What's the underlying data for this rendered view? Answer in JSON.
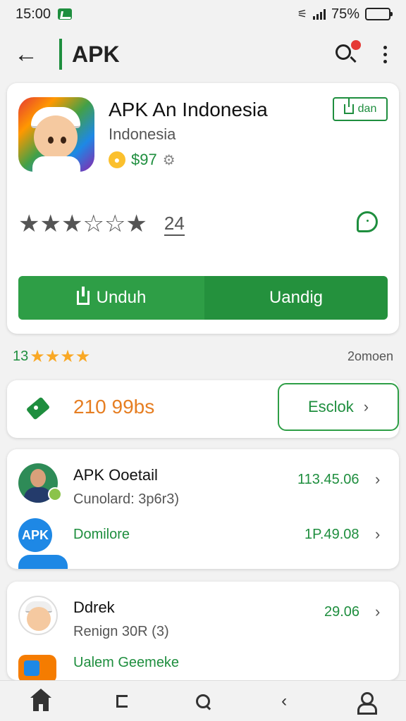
{
  "status_bar": {
    "time": "15:00",
    "battery": "75%",
    "battery_level": 0.75
  },
  "app_bar": {
    "title": "APK"
  },
  "app_card": {
    "name": "APK An Indonesia",
    "subtitle": "Indonesia",
    "price": "$97",
    "share_label": "dan",
    "rating_stars": 3,
    "rating_count": "24",
    "download_label": "Unduh",
    "secondary_label": "Uandig"
  },
  "stats": {
    "count": "13",
    "stars": "★★★★",
    "right_text": "2omoen"
  },
  "size_card": {
    "size": "210 99bs",
    "button_label": "Esclok"
  },
  "info_rows": [
    {
      "title": "APK Ooetail",
      "subtitle": "Cunolard: 3p6r3)",
      "value": "113.45.06"
    },
    {
      "badge": "APK",
      "green_text": "Domilore",
      "value": "1P.49.08"
    }
  ],
  "info_rows2": [
    {
      "title": "Ddrek",
      "subtitle": "Renign 30R (3)",
      "value": "29.06"
    },
    {
      "green_text": "Ualem Geemeke"
    }
  ],
  "icons": {
    "back": "arrow-left-icon",
    "search": "search-icon",
    "more": "more-vert-icon",
    "nav": [
      "home-icon",
      "recents-icon",
      "search-icon",
      "back-icon",
      "profile-icon"
    ]
  },
  "colors": {
    "accent": "#1e8e3e",
    "price_orange": "#e67e22",
    "star_yellow": "#f9a825",
    "badge_red": "#e53935",
    "apk_blue": "#1e88e5"
  }
}
